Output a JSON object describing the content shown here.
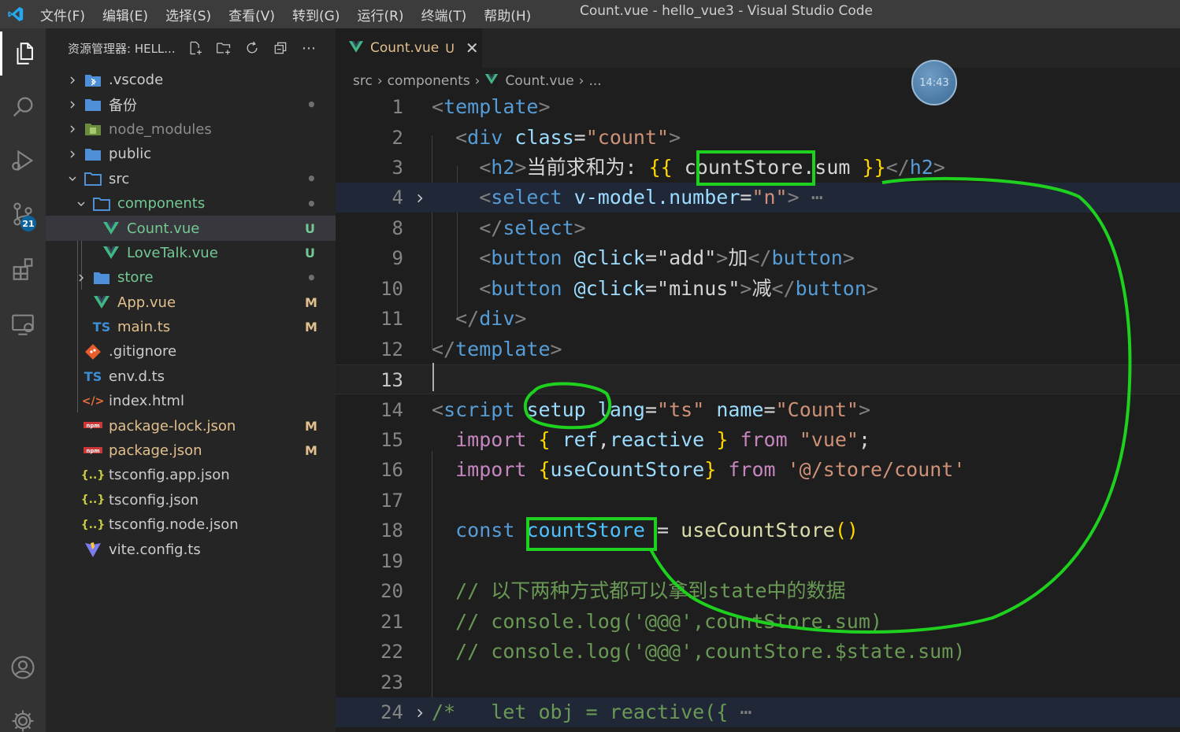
{
  "window": {
    "title": "Count.vue - hello_vue3 - Visual Studio Code",
    "menu": [
      "文件(F)",
      "编辑(E)",
      "选择(S)",
      "查看(V)",
      "转到(G)",
      "运行(R)",
      "终端(T)",
      "帮助(H)"
    ]
  },
  "activity": {
    "scm_badge": "21",
    "items": [
      "explorer-icon",
      "search-icon",
      "run-debug-icon",
      "source-control-icon",
      "extensions-icon",
      "remote-explorer-icon",
      "accounts-icon",
      "settings-gear-icon"
    ]
  },
  "explorer": {
    "title": "资源管理器: HELL...",
    "items": [
      {
        "name": ".vscode",
        "type": "folder",
        "status": "",
        "icon": "vscode-folder-icon"
      },
      {
        "name": "备份",
        "type": "folder",
        "status": "•",
        "icon": "folder-icon"
      },
      {
        "name": "node_modules",
        "type": "folder",
        "status": "",
        "icon": "node-modules-folder-icon"
      },
      {
        "name": "public",
        "type": "folder",
        "status": "",
        "icon": "folder-icon"
      },
      {
        "name": "src",
        "type": "folder-open",
        "status": "•",
        "icon": "folder-open-icon"
      },
      {
        "name": "components",
        "type": "folder-open",
        "status": "•",
        "icon": "folder-open-icon"
      },
      {
        "name": "Count.vue",
        "type": "file",
        "status": "U",
        "icon": "vue-icon"
      },
      {
        "name": "LoveTalk.vue",
        "type": "file",
        "status": "U",
        "icon": "vue-icon"
      },
      {
        "name": "store",
        "type": "folder",
        "status": "•",
        "icon": "folder-icon"
      },
      {
        "name": "App.vue",
        "type": "file",
        "status": "M",
        "icon": "vue-icon"
      },
      {
        "name": "main.ts",
        "type": "file",
        "status": "M",
        "icon": "typescript-icon"
      },
      {
        "name": ".gitignore",
        "type": "file",
        "status": "",
        "icon": "git-icon"
      },
      {
        "name": "env.d.ts",
        "type": "file",
        "status": "",
        "icon": "typescript-icon"
      },
      {
        "name": "index.html",
        "type": "file",
        "status": "",
        "icon": "html-icon"
      },
      {
        "name": "package-lock.json",
        "type": "file",
        "status": "M",
        "icon": "npm-icon"
      },
      {
        "name": "package.json",
        "type": "file",
        "status": "M",
        "icon": "npm-icon"
      },
      {
        "name": "tsconfig.app.json",
        "type": "file",
        "status": "",
        "icon": "json-icon"
      },
      {
        "name": "tsconfig.json",
        "type": "file",
        "status": "",
        "icon": "json-icon"
      },
      {
        "name": "tsconfig.node.json",
        "type": "file",
        "status": "",
        "icon": "json-icon"
      },
      {
        "name": "vite.config.ts",
        "type": "file",
        "status": "",
        "icon": "vite-icon"
      }
    ]
  },
  "tab": {
    "name": "Count.vue",
    "status": "U",
    "close": "✕"
  },
  "breadcrumb": {
    "parts": [
      "src",
      "components",
      "Count.vue",
      "..."
    ]
  },
  "overlay_clock": "14:43",
  "code": {
    "line_numbers": [
      "1",
      "2",
      "3",
      "4",
      "8",
      "9",
      "10",
      "11",
      "12",
      "13",
      "14",
      "15",
      "16",
      "17",
      "18",
      "19",
      "20",
      "21",
      "22",
      "23",
      "24"
    ],
    "lines": [
      "<template>",
      "  <div class=\"count\">",
      "    <h2>当前求和为: {{ countStore.sum }}</h2>",
      "    <select v-model.number=\"n\"> ⋯",
      "    </select>",
      "    <button @click=\"add\">加</button>",
      "    <button @click=\"minus\">减</button>",
      "  </div>",
      "</template>",
      "",
      "<script setup lang=\"ts\" name=\"Count\">",
      "  import { ref,reactive } from \"vue\";",
      "  import {useCountStore} from '@/store/count'",
      "",
      "  const countStore = useCountStore()",
      "",
      "  // 以下两种方式都可以拿到state中的数据",
      "  // console.log('@@@',countStore.sum)",
      "  // console.log('@@@',countStore.$state.sum)",
      "",
      "/*   let obj = reactive({ ⋯"
    ]
  },
  "colors": {
    "annotation": "#1ed11e",
    "background": "#1e1e1e",
    "sidebar": "#252526",
    "activitybar": "#333333",
    "titlebar": "#3c3c3c",
    "untracked": "#73c991",
    "modified": "#e2c08d"
  }
}
